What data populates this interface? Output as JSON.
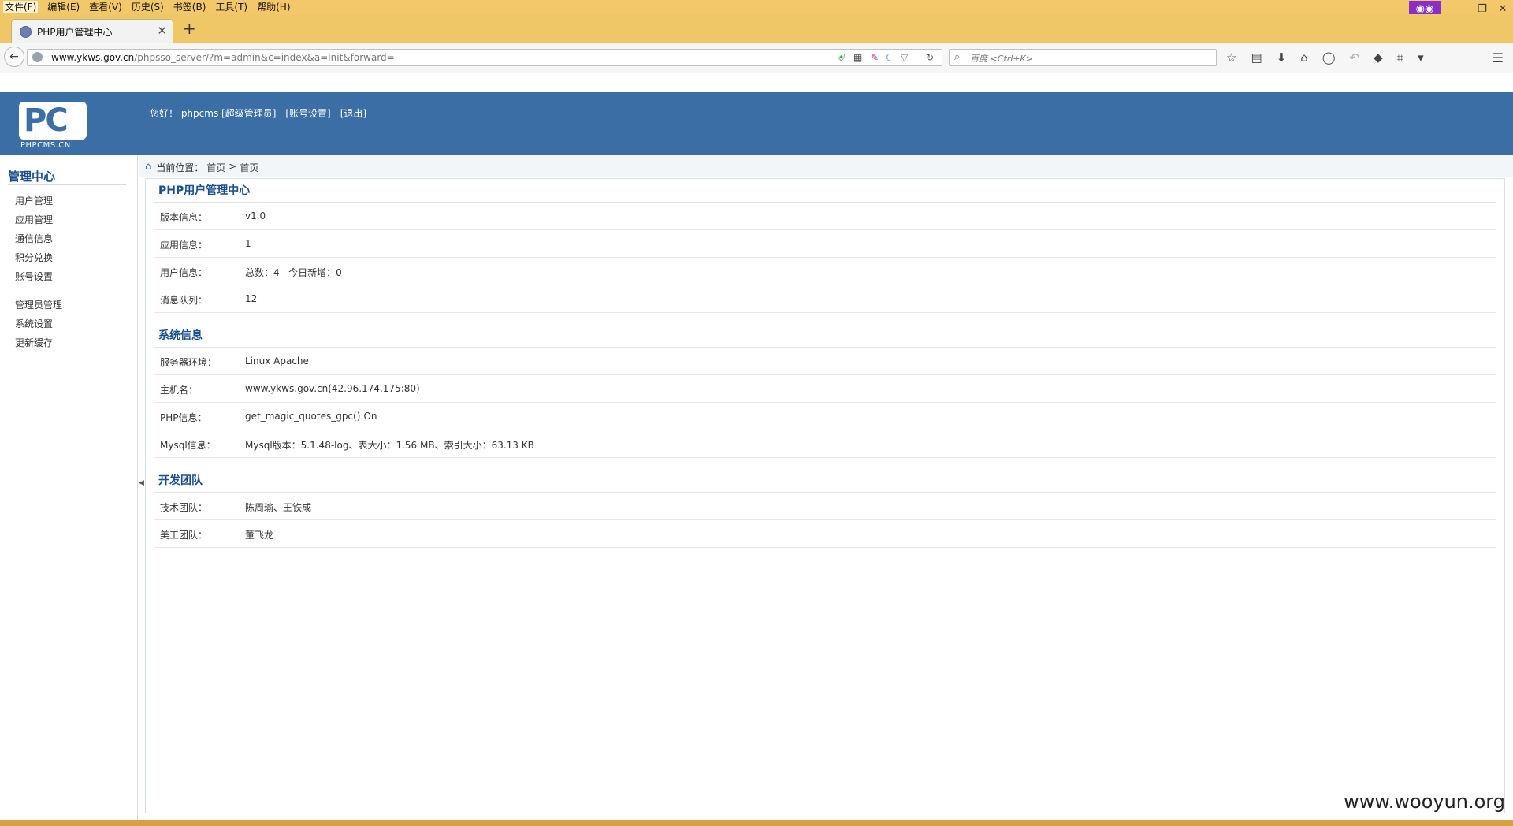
{
  "browser": {
    "menu": [
      "文件(F)",
      "编辑(E)",
      "查看(V)",
      "历史(S)",
      "书签(B)",
      "工具(T)",
      "帮助(H)"
    ],
    "tab_title": "PHP用户管理中心",
    "url_host": "www.ykws.gov.cn",
    "url_path": "/phpsso_server/?m=admin&c=index&a=init&forward=",
    "search_placeholder": "百度 <Ctrl+K>"
  },
  "header": {
    "logo_text": "PC",
    "logo_sub": "PHPCMS.CN",
    "greeting": "您好！ phpcms [超级管理员]",
    "account_settings": "[账号设置]",
    "logout": "[退出]"
  },
  "sidebar": {
    "title": "管理中心",
    "group1": [
      "用户管理",
      "应用管理",
      "通信信息",
      "积分兑换",
      "账号设置"
    ],
    "group2": [
      "管理员管理",
      "系统设置",
      "更新缓存"
    ]
  },
  "breadcrumb": {
    "label": "当前位置：",
    "items": [
      "首页",
      ">",
      "首页"
    ]
  },
  "sections": {
    "app": {
      "title": "PHP用户管理中心",
      "rows": [
        {
          "k": "版本信息：",
          "v": "v1.0"
        },
        {
          "k": "应用信息：",
          "v": "1"
        },
        {
          "k": "用户信息：",
          "v": "总数：4   今日新增：0"
        },
        {
          "k": "消息队列：",
          "v": "12"
        }
      ]
    },
    "system": {
      "title": "系统信息",
      "rows": [
        {
          "k": "服务器环境：",
          "v": "Linux Apache"
        },
        {
          "k": "主机名：",
          "v": "www.ykws.gov.cn(42.96.174.175:80)"
        },
        {
          "k": "PHP信息：",
          "v": "get_magic_quotes_gpc():On"
        },
        {
          "k": "Mysql信息：",
          "v": "Mysql版本：5.1.48-log、表大小：1.56 MB、索引大小：63.13 KB"
        }
      ]
    },
    "team": {
      "title": "开发团队",
      "rows": [
        {
          "k": "技术团队：",
          "v": "陈周瑜、王铁成"
        },
        {
          "k": "美工团队：",
          "v": "董飞龙"
        }
      ]
    }
  },
  "watermark": "www.wooyun.org"
}
